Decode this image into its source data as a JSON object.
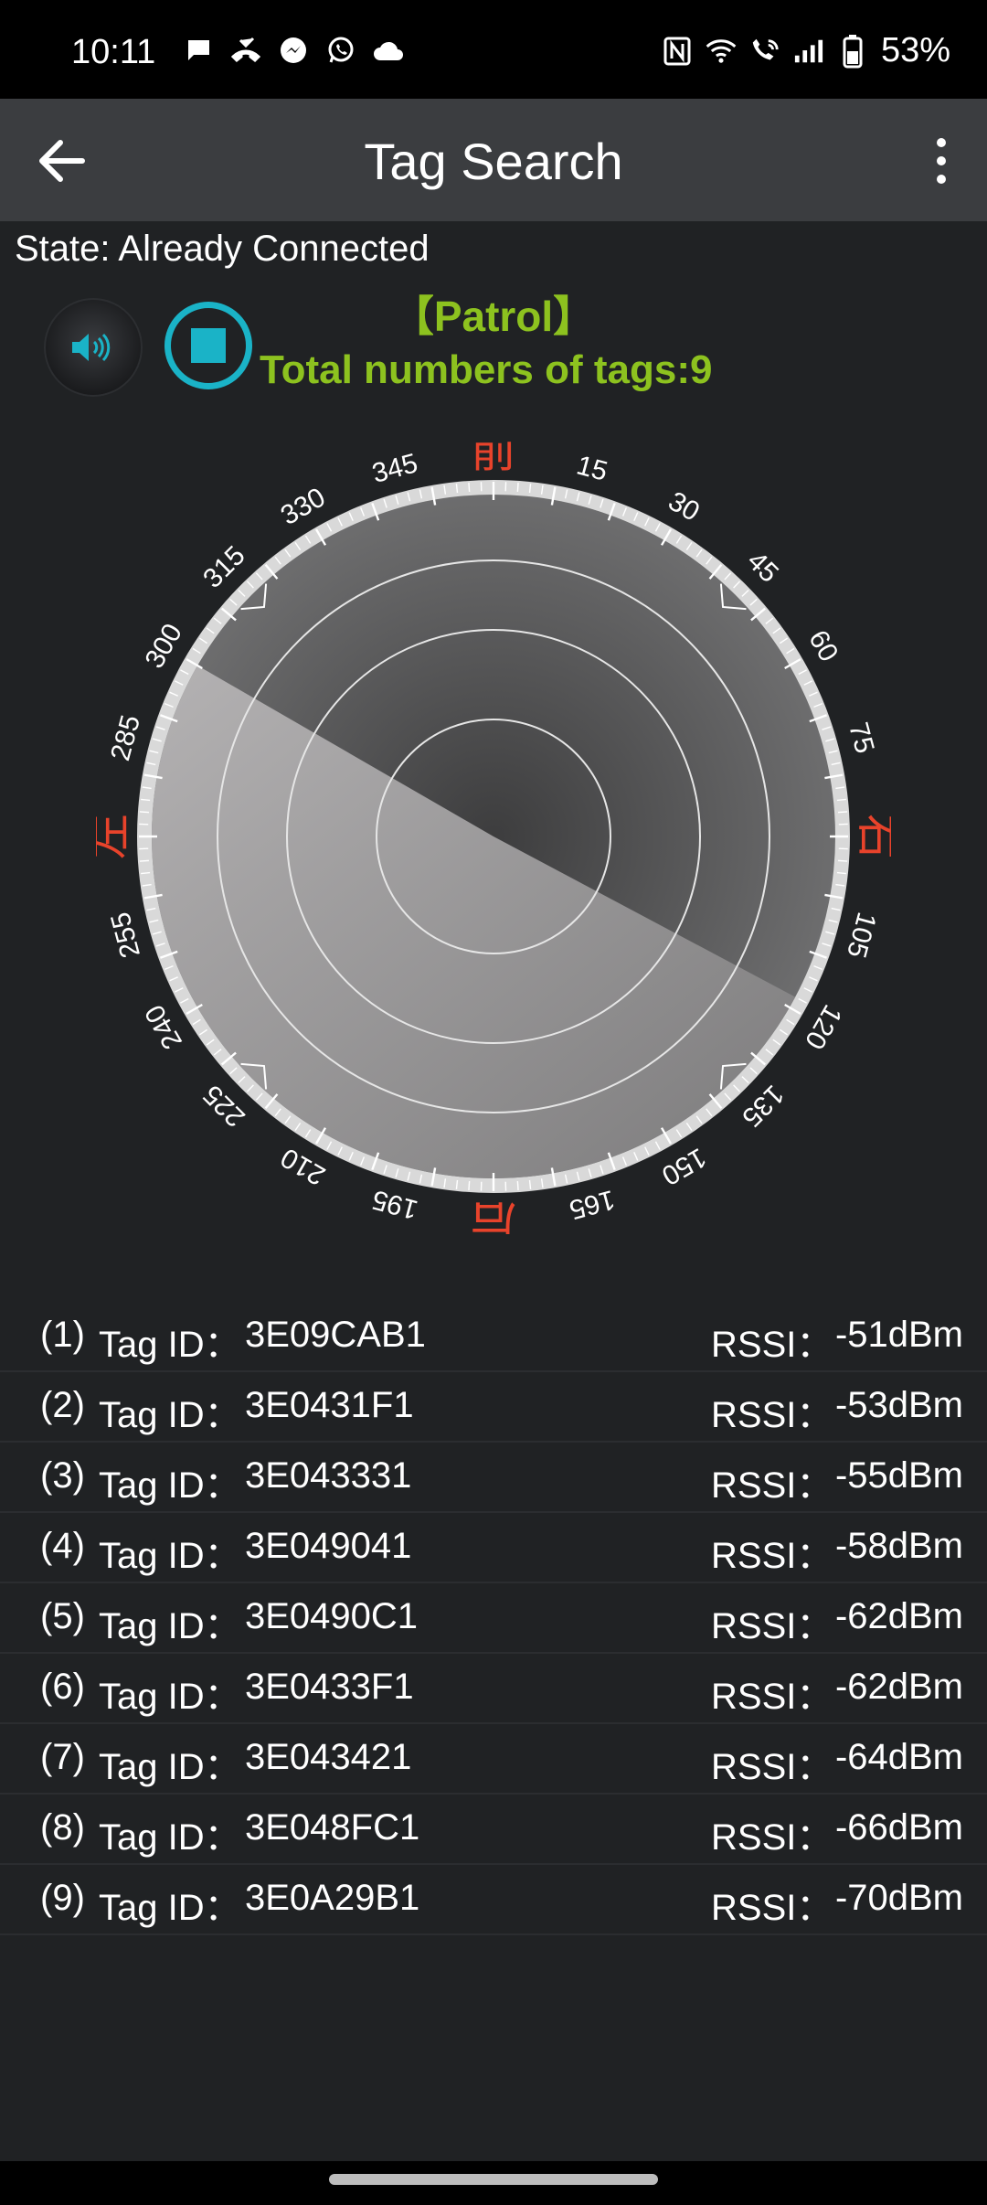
{
  "status_bar": {
    "time": "10:11",
    "battery": "53%",
    "left_icons": [
      "chat-icon",
      "missed-call-icon",
      "messenger-icon",
      "whatsapp-icon",
      "cloud-icon"
    ],
    "right_icons": [
      "nfc-icon",
      "wifi-icon",
      "wifi-calling-icon",
      "signal-icon",
      "battery-icon"
    ]
  },
  "app_bar": {
    "title": "Tag Search",
    "back_icon": "arrow-left-icon",
    "menu_icon": "more-vert-icon"
  },
  "state": "State: Already Connected",
  "mode": "【Patrol】",
  "total_tags": "Total numbers of tags:9",
  "colors": {
    "accent_green": "#8dc21f",
    "accent_cyan": "#1ab3c7",
    "direction_red": "#e8432b",
    "appbar": "#3b3d40",
    "background": "#202224"
  },
  "compass": {
    "directions": {
      "front": "前",
      "back": "后",
      "left": "左",
      "right": "右"
    },
    "tick_labels": [
      "15",
      "30",
      "45",
      "60",
      "75",
      "105",
      "120",
      "135",
      "150",
      "165",
      "195",
      "210",
      "225",
      "240",
      "255",
      "285",
      "300",
      "315",
      "330",
      "345"
    ],
    "sweep_start_deg": 118,
    "sweep_end_deg": 300
  },
  "tags": [
    {
      "index": "(1)",
      "label": "Tag ID：",
      "id": "3E09CAB1",
      "rssi_label": "RSSI：",
      "rssi": "-51dBm"
    },
    {
      "index": "(2)",
      "label": "Tag ID：",
      "id": "3E0431F1",
      "rssi_label": "RSSI：",
      "rssi": "-53dBm"
    },
    {
      "index": "(3)",
      "label": "Tag ID：",
      "id": "3E043331",
      "rssi_label": "RSSI：",
      "rssi": "-55dBm"
    },
    {
      "index": "(4)",
      "label": "Tag ID：",
      "id": "3E049041",
      "rssi_label": "RSSI：",
      "rssi": "-58dBm"
    },
    {
      "index": "(5)",
      "label": "Tag ID：",
      "id": "3E0490C1",
      "rssi_label": "RSSI：",
      "rssi": "-62dBm"
    },
    {
      "index": "(6)",
      "label": "Tag ID：",
      "id": "3E0433F1",
      "rssi_label": "RSSI：",
      "rssi": "-62dBm"
    },
    {
      "index": "(7)",
      "label": "Tag ID：",
      "id": "3E043421",
      "rssi_label": "RSSI：",
      "rssi": "-64dBm"
    },
    {
      "index": "(8)",
      "label": "Tag ID：",
      "id": "3E048FC1",
      "rssi_label": "RSSI：",
      "rssi": "-66dBm"
    },
    {
      "index": "(9)",
      "label": "Tag ID：",
      "id": "3E0A29B1",
      "rssi_label": "RSSI：",
      "rssi": "-70dBm"
    }
  ]
}
